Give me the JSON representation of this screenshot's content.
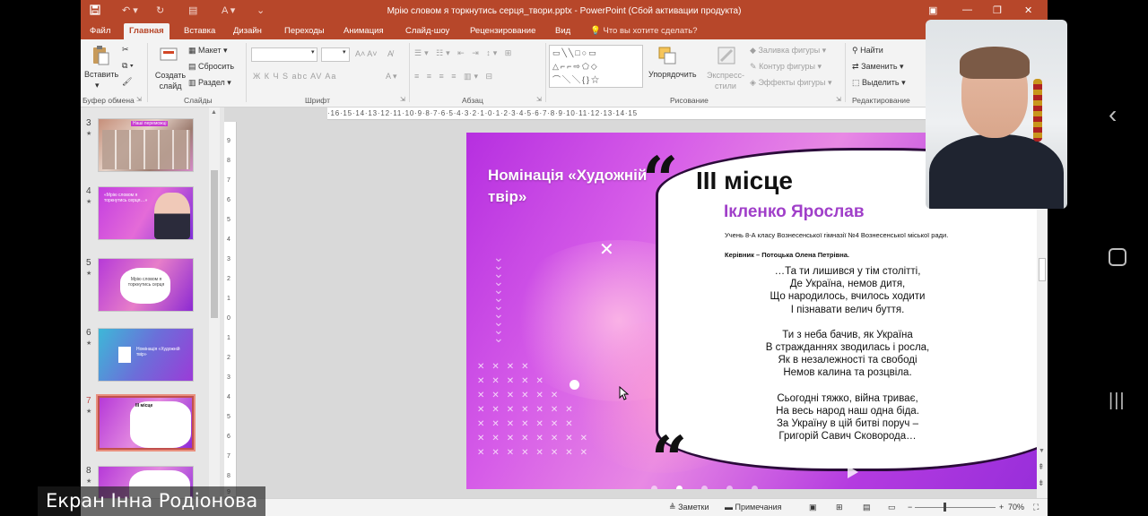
{
  "window": {
    "title": "Мрію словом я торкнутись серця_твори.pptx - PowerPoint (Сбой активации продукта)"
  },
  "tabs": [
    "Файл",
    "Главная",
    "Вставка",
    "Дизайн",
    "Переходы",
    "Анимация",
    "Слайд-шоу",
    "Рецензирование",
    "Вид"
  ],
  "tell_me": "Что вы хотите сделать?",
  "ribbon": {
    "paste": "Вставить",
    "clipboard_group": "Буфер обмена",
    "new_slide": "Создать слайд",
    "layout": "Макет",
    "reset": "Сбросить",
    "section": "Раздел",
    "slides_group": "Слайды",
    "font_group": "Шрифт",
    "font_buttons": "Ж  К  Ч  S  abc  AV  Aa",
    "paragraph_group": "Абзац",
    "arrange": "Упорядочить",
    "quick_styles": "Экспресс-стили",
    "shape_fill": "Заливка фигуры",
    "shape_outline": "Контур фигуры",
    "shape_effects": "Эффекты фигуры",
    "drawing_group": "Рисование",
    "find": "Найти",
    "replace": "Заменить",
    "select": "Выделить",
    "editing_group": "Редактирование"
  },
  "slides_pane": {
    "thumbnails": [
      {
        "num": "3",
        "text": "Наші переможці"
      },
      {
        "num": "4",
        "text": "«Мрію словом я торкнутись серця…»"
      },
      {
        "num": "5",
        "text": "Мрію словом я торкнутись серця"
      },
      {
        "num": "6",
        "text": "Номінація «Художній твір»"
      },
      {
        "num": "7",
        "text": "III місце"
      },
      {
        "num": "8",
        "text": ""
      }
    ],
    "selected": "7"
  },
  "ruler": {
    "horizontal": "·16·15·14·13·12·11·10·9·8·7·6·5·4·3·2·1·0·1·2·3·4·5·6·7·8·9·10·11·12·13·14·15",
    "vertical": [
      "9",
      "8",
      "7",
      "6",
      "5",
      "4",
      "3",
      "2",
      "1",
      "0",
      "1",
      "2",
      "3",
      "4",
      "5",
      "6",
      "7",
      "8",
      "9"
    ]
  },
  "slide": {
    "nomination": "Номінація «Художній твір»",
    "place": "ІІІ місце",
    "author": "Ікленко Ярослав",
    "student_info": "Учень 8-А класу Вознесенської гімназії №4 Вознесенської міської ради.",
    "supervisor": "Керівник – Потоцька Олена Петрівна.",
    "stanzas": [
      [
        "…Та ти лишився у тім столітті,",
        "Де Україна, немов дитя,",
        "Що народилось, вчилось ходити",
        "І пізнавати велич буття."
      ],
      [
        "Ти з неба бачив, як Україна",
        "В стражданнях зводилась і росла,",
        "Як в незалежності та свободі",
        "Немов калина та розцвіла."
      ],
      [
        "Сьогодні тяжко, війна триває,",
        "На весь народ наш одна біда.",
        "За Україну в цій битві поруч –",
        "Григорій Савич Сковорода…"
      ]
    ],
    "accent": "#a03fc9"
  },
  "statusbar": {
    "notes": "Заметки",
    "comments": "Примечания",
    "zoom": "70%"
  },
  "presenter_label": "Екран Інна Родіонова"
}
